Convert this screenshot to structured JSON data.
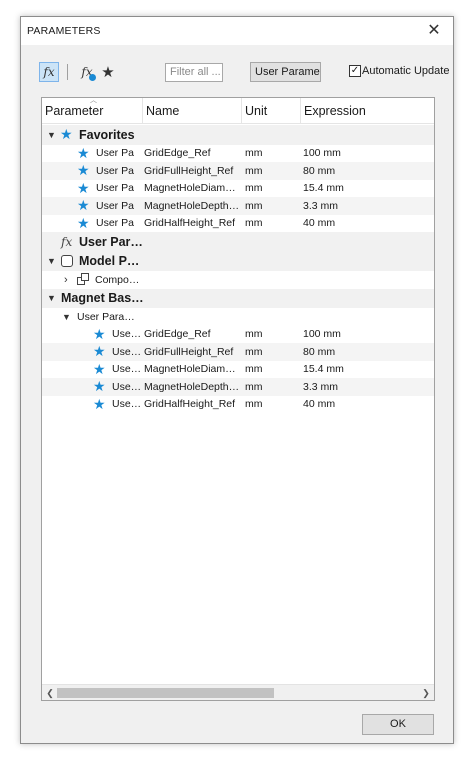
{
  "dialog": {
    "title": "PARAMETERS",
    "close_glyph": "✕"
  },
  "toolbar": {
    "fx_icon": "fx",
    "filter_placeholder": "Filter all ...",
    "user_param_button": "User Paramet",
    "auto_update_label": "Automatic Update",
    "auto_update_checked": true
  },
  "columns": [
    "Parameter",
    "Name",
    "Unit",
    "Expression"
  ],
  "favorites": {
    "label": "Favorites",
    "rows": [
      {
        "param": "User Pa",
        "name": "GridEdge_Ref",
        "unit": "mm",
        "expr": "100 mm"
      },
      {
        "param": "User Pa",
        "name": "GridFullHeight_Ref",
        "unit": "mm",
        "expr": "80 mm"
      },
      {
        "param": "User Pa",
        "name": "MagnetHoleDiam…",
        "unit": "mm",
        "expr": "15.4 mm"
      },
      {
        "param": "User Pa",
        "name": "MagnetHoleDepth…",
        "unit": "mm",
        "expr": "3.3 mm"
      },
      {
        "param": "User Pa",
        "name": "GridHalfHeight_Ref",
        "unit": "mm",
        "expr": "40 mm"
      }
    ]
  },
  "user_params": {
    "label": "User Par…"
  },
  "model_params": {
    "label": "Model P…",
    "child": "Compo…"
  },
  "magnet": {
    "label": "Magnet Bas…",
    "sub_label": "User Para…",
    "rows": [
      {
        "param": "Use…",
        "name": "GridEdge_Ref",
        "unit": "mm",
        "expr": "100 mm"
      },
      {
        "param": "Use…",
        "name": "GridFullHeight_Ref",
        "unit": "mm",
        "expr": "80 mm"
      },
      {
        "param": "Use…",
        "name": "MagnetHoleDiam…",
        "unit": "mm",
        "expr": "15.4 mm"
      },
      {
        "param": "Use…",
        "name": "MagnetHoleDepth…",
        "unit": "mm",
        "expr": "3.3 mm"
      },
      {
        "param": "Use…",
        "name": "GridHalfHeight_Ref",
        "unit": "mm",
        "expr": "40 mm"
      }
    ]
  },
  "footer": {
    "ok_label": "OK"
  },
  "colors": {
    "accent": "#1a8ad4",
    "selection": "#cce4f7"
  },
  "icons": [
    "fx-icon",
    "fx-linked-icon",
    "star-icon",
    "checkbox-icon",
    "chevron-down-icon",
    "chevron-right-icon",
    "component-icon",
    "close-icon"
  ]
}
